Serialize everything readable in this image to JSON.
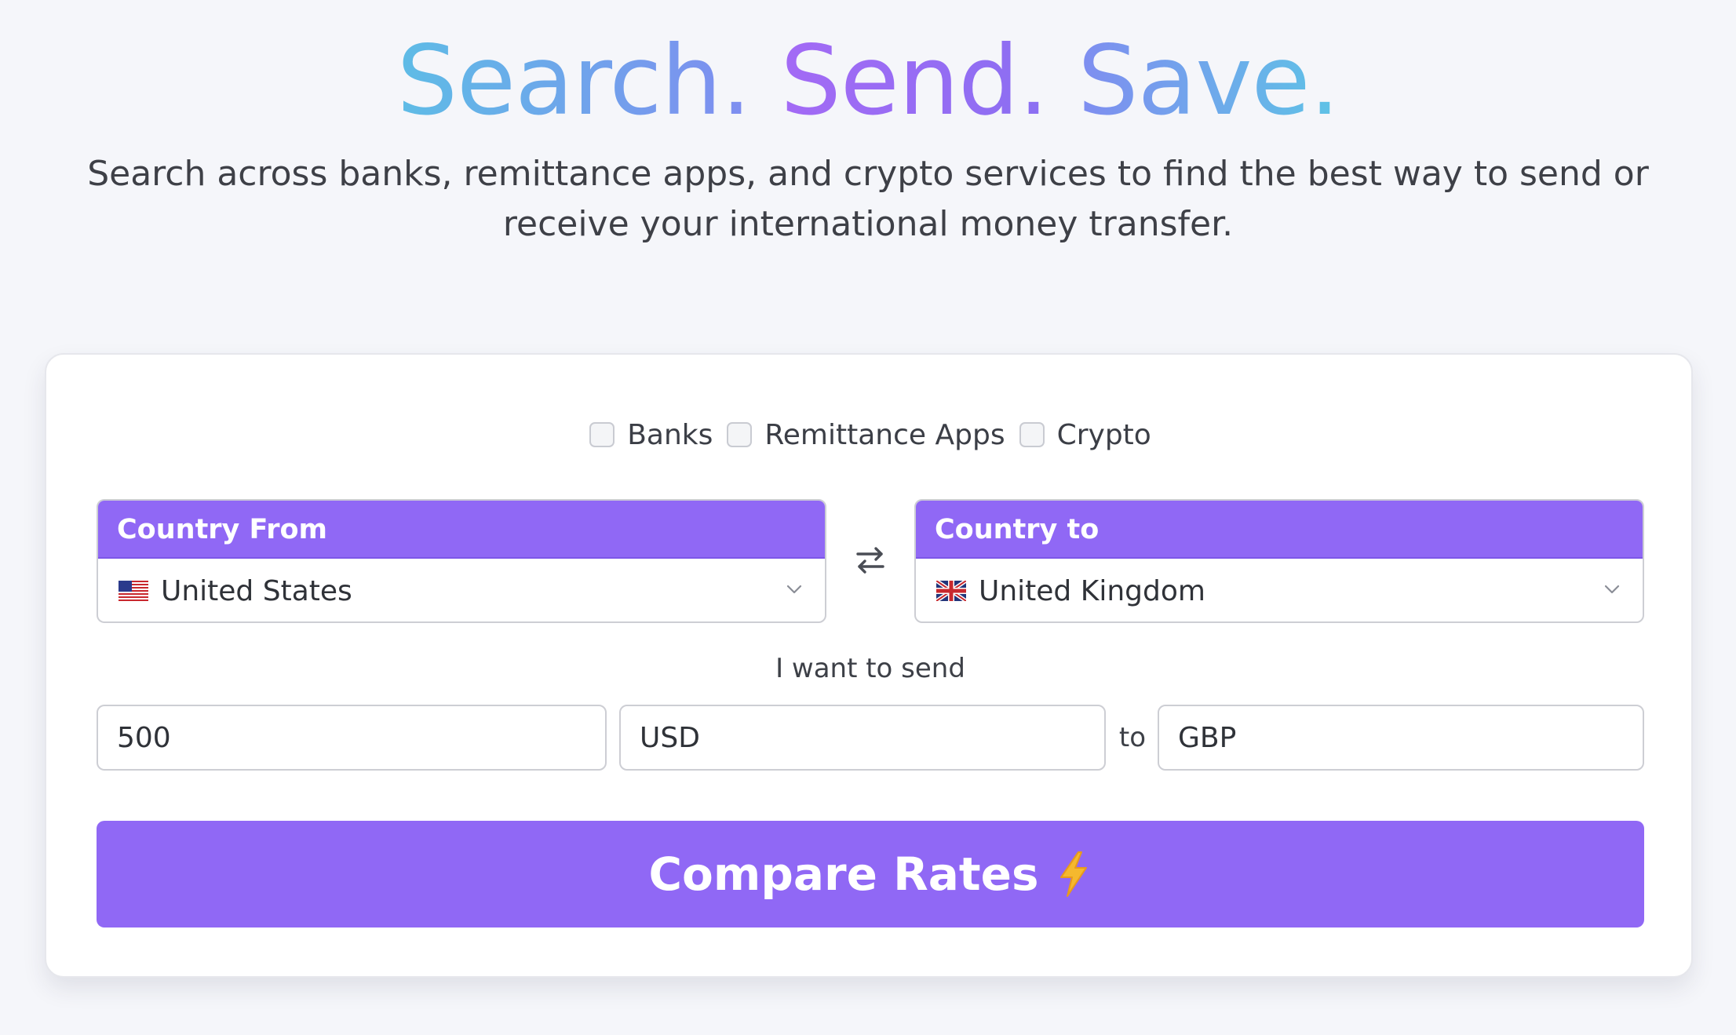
{
  "hero": {
    "title_word_1": "Search.",
    "title_word_2": "Send.",
    "title_word_3": "Save.",
    "subtitle": "Search across banks, remittance apps, and crypto services to find the best way to send or receive your international money transfer."
  },
  "filters": [
    {
      "label": "Banks",
      "checked": false
    },
    {
      "label": "Remittance Apps",
      "checked": false
    },
    {
      "label": "Crypto",
      "checked": false
    }
  ],
  "country_from": {
    "header": "Country From",
    "selected": "United States",
    "flag_icon": "us-flag-icon"
  },
  "country_to": {
    "header": "Country to",
    "selected": "United Kingdom",
    "flag_icon": "uk-flag-icon"
  },
  "send": {
    "label": "I want to send",
    "amount": "500",
    "from_currency": "USD",
    "to_word": "to",
    "to_currency": "GBP"
  },
  "cta": {
    "label": "Compare Rates",
    "icon": "lightning-icon"
  },
  "colors": {
    "accent": "#9068f5",
    "background": "#f5f6fa",
    "title_gradient_start": "#5ebce6",
    "title_gradient_mid": "#a36af5"
  }
}
